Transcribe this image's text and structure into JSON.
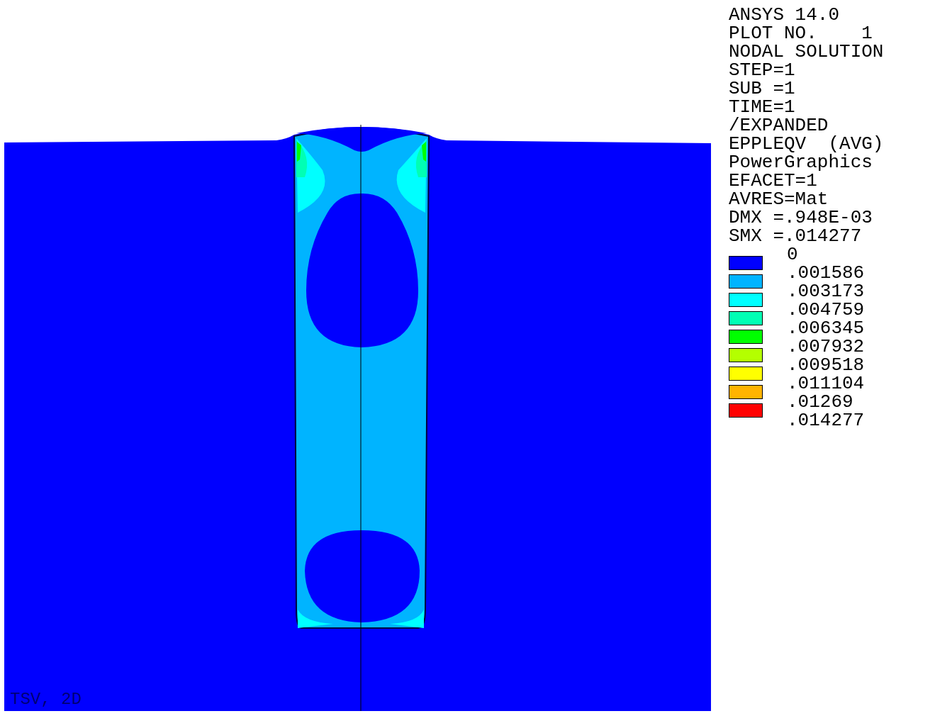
{
  "plot_title": "TSV, 2D",
  "info_lines": [
    "ANSYS 14.0",
    "PLOT NO.    1",
    "NODAL SOLUTION",
    "STEP=1",
    "SUB =1",
    "TIME=1",
    "/EXPANDED",
    "EPPLEQV  (AVG)",
    "PowerGraphics",
    "EFACET=1",
    "AVRES=Mat",
    "DMX =.948E-03",
    "SMX =.014277"
  ],
  "legend": {
    "labels": [
      "0",
      ".001586",
      ".003173",
      ".004759",
      ".006345",
      ".007932",
      ".009518",
      ".011104",
      ".01269",
      ".014277"
    ],
    "bands": [
      {
        "color": "#0000ff"
      },
      {
        "color": "#00b4ff"
      },
      {
        "color": "#00ffff"
      },
      {
        "color": "#00ffb4"
      },
      {
        "color": "#00ff00"
      },
      {
        "color": "#b4ff00"
      },
      {
        "color": "#ffff00"
      },
      {
        "color": "#ffb400"
      },
      {
        "color": "#ff0000"
      }
    ]
  }
}
